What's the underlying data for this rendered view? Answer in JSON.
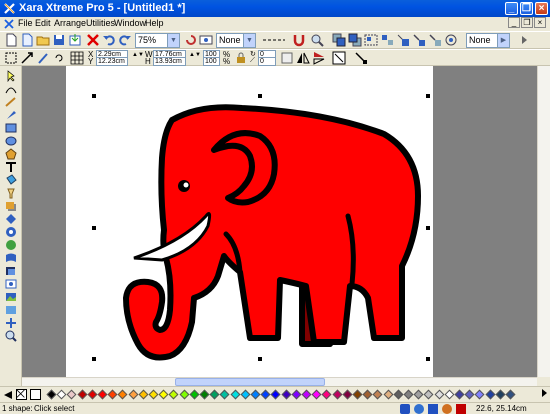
{
  "window": {
    "title": "Xara Xtreme Pro 5 - [Untitled1 *]"
  },
  "menu": [
    "File",
    "Edit",
    "Arrange",
    "Utilities",
    "Window",
    "Help"
  ],
  "toolbar": {
    "zoom_value": "75%",
    "quality_value": "None",
    "fill_value": "None"
  },
  "infobar": {
    "x_label": "X",
    "y_label": "Y",
    "x_value": "2.29cm",
    "y_value": "12.23cm",
    "w_label": "W",
    "h_label": "H",
    "w_value": "17.76cm",
    "h_value": "13.93cm",
    "scale_x": "100",
    "scale_y": "100",
    "pct": "%",
    "rotation": "0",
    "skew": "0"
  },
  "palette_colors": [
    "#000000",
    "#ffffff",
    "#e8c8c8",
    "#c00000",
    "#e00000",
    "#ff0000",
    "#ff4000",
    "#ff8000",
    "#ffa040",
    "#ffc000",
    "#ffe000",
    "#ffff00",
    "#c0ff00",
    "#80ff00",
    "#00c000",
    "#008000",
    "#00a060",
    "#00c0a0",
    "#00e0e0",
    "#00c0ff",
    "#0080ff",
    "#0040ff",
    "#0000ff",
    "#4000c0",
    "#8000ff",
    "#c000ff",
    "#ff00ff",
    "#ff0080",
    "#c00060",
    "#800040",
    "#804000",
    "#a06030",
    "#c08050",
    "#e0b080",
    "#606060",
    "#808080",
    "#a0a0a0",
    "#c0c0c0",
    "#e0e0e0",
    "#ffffff",
    "#4040a0",
    "#6060c0",
    "#8080ff",
    "#2040a0",
    "#204060",
    "#305080"
  ],
  "statusbar": {
    "selection": "1 shape:",
    "hint": "Click select",
    "coords": "22.6, 25.14cm"
  }
}
